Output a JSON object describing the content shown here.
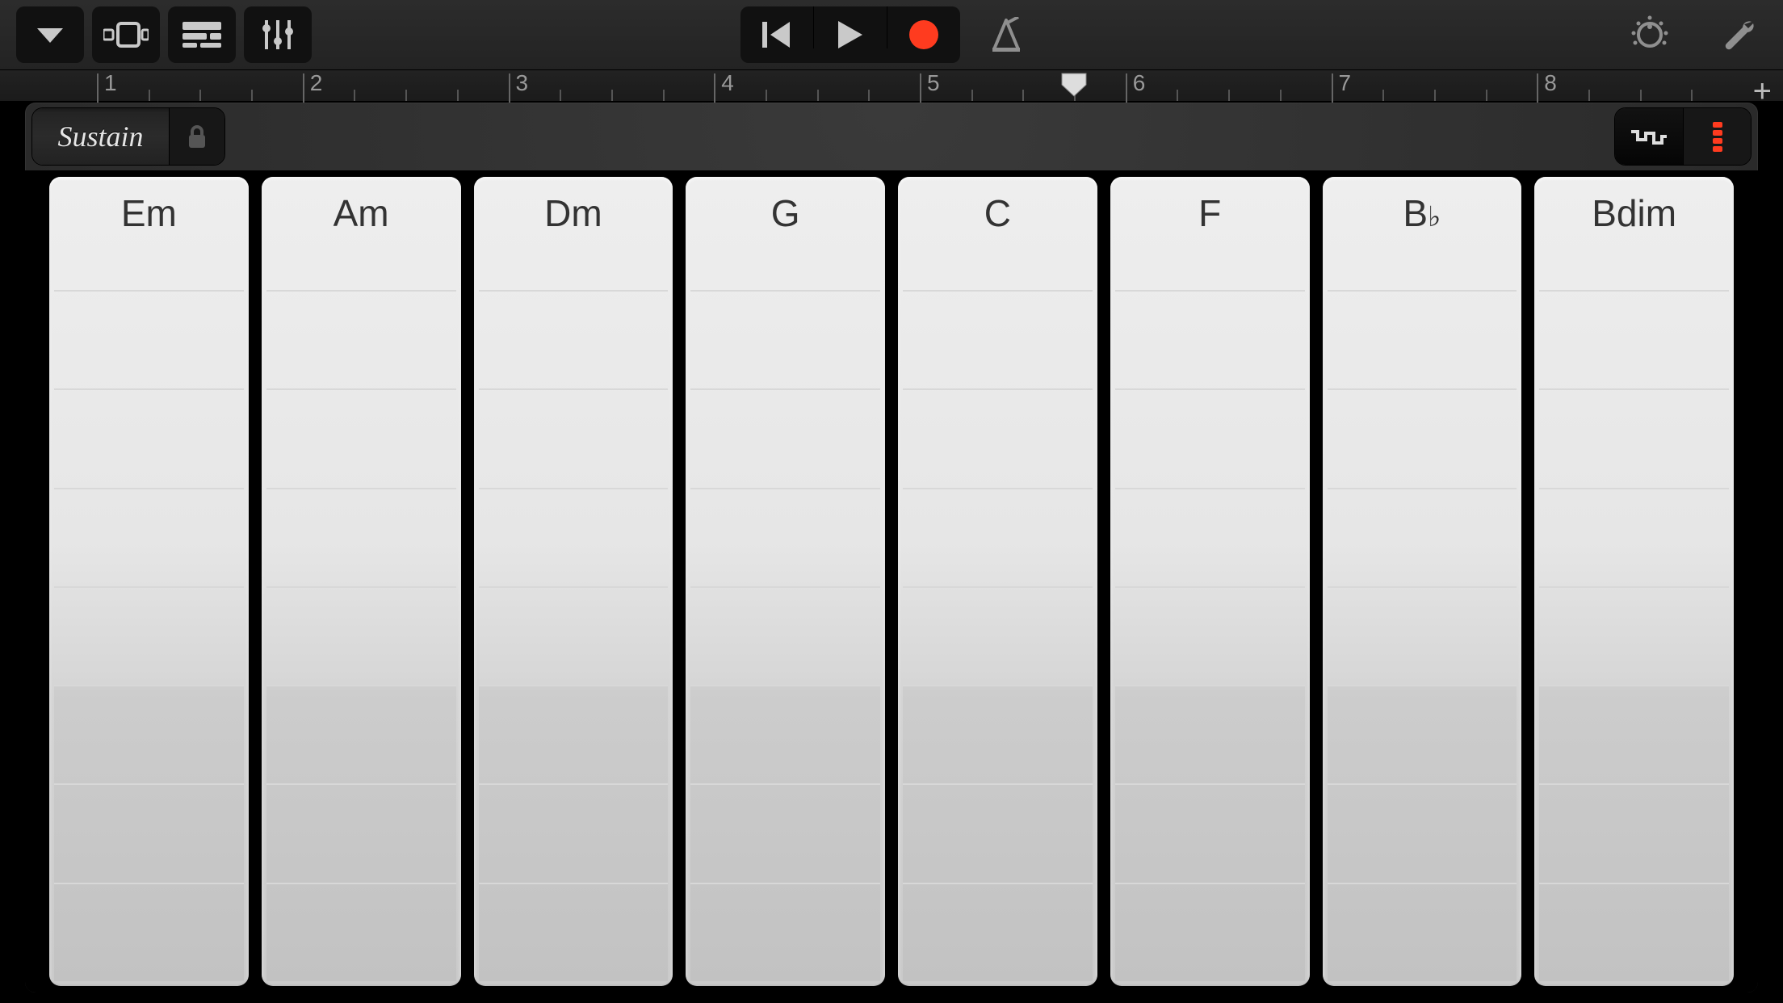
{
  "toolbar": {
    "menu_icon": "chevron-down",
    "browser_icon": "browser",
    "tracks_icon": "tracks",
    "controls_icon": "mixer",
    "rewind_icon": "go-to-start",
    "play_icon": "play",
    "record_icon": "record",
    "record_color": "#ff3b1f",
    "metronome_icon": "metronome",
    "dial_icon": "dial",
    "settings_icon": "wrench"
  },
  "ruler": {
    "bars": [
      "1",
      "2",
      "3",
      "4",
      "5",
      "6",
      "7",
      "8"
    ],
    "subdivisions_per_bar": 4,
    "playhead_bar": 5.75,
    "add_label": "+"
  },
  "panel": {
    "sustain_label": "Sustain",
    "lock_icon": "lock",
    "mode_notes_icon": "stepped-line",
    "mode_chords_icon": "chord-stack",
    "mode_chords_active_color": "#ff3b1f"
  },
  "chords": [
    {
      "label": "Em"
    },
    {
      "label": "Am"
    },
    {
      "label": "Dm"
    },
    {
      "label": "G"
    },
    {
      "label": "C"
    },
    {
      "label": "F"
    },
    {
      "label": "B",
      "accidental": "♭"
    },
    {
      "label": "Bdim"
    }
  ]
}
